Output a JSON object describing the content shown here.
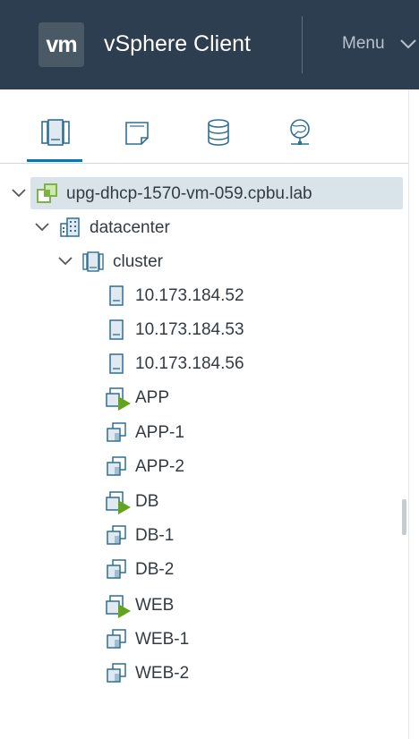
{
  "header": {
    "logo_text": "vm",
    "app_title": "vSphere Client",
    "menu_label": "Menu",
    "background": "#2c3e4f"
  },
  "navigator_tabs": [
    {
      "name": "hosts-and-clusters",
      "icon": "hosts-clusters-icon",
      "active": true
    },
    {
      "name": "vms-and-templates",
      "icon": "vm-templates-icon",
      "active": false
    },
    {
      "name": "storage",
      "icon": "datastore-icon",
      "active": false
    },
    {
      "name": "networking",
      "icon": "network-globe-icon",
      "active": false
    }
  ],
  "tree": {
    "vcenter": {
      "label": "upg-dhcp-1570-vm-059.cpbu.lab",
      "expanded": true,
      "selected": true
    },
    "datacenter": {
      "label": "datacenter",
      "expanded": true
    },
    "cluster": {
      "label": "cluster",
      "expanded": true
    },
    "hosts": [
      {
        "label": "10.173.184.52"
      },
      {
        "label": "10.173.184.53"
      },
      {
        "label": "10.173.184.56"
      }
    ],
    "vms": [
      {
        "label": "APP",
        "powered_on": true
      },
      {
        "label": "APP-1",
        "powered_on": false
      },
      {
        "label": "APP-2",
        "powered_on": false
      },
      {
        "label": "DB",
        "powered_on": true
      },
      {
        "label": "DB-1",
        "powered_on": false
      },
      {
        "label": "DB-2",
        "powered_on": false
      },
      {
        "label": "WEB",
        "powered_on": true
      },
      {
        "label": "WEB-1",
        "powered_on": false
      },
      {
        "label": "WEB-2",
        "powered_on": false
      }
    ]
  },
  "colors": {
    "accent": "#0079b8",
    "power_on": "#62a420",
    "vcenter_icon": "#7cb342",
    "selection": "#d9e4ea"
  }
}
